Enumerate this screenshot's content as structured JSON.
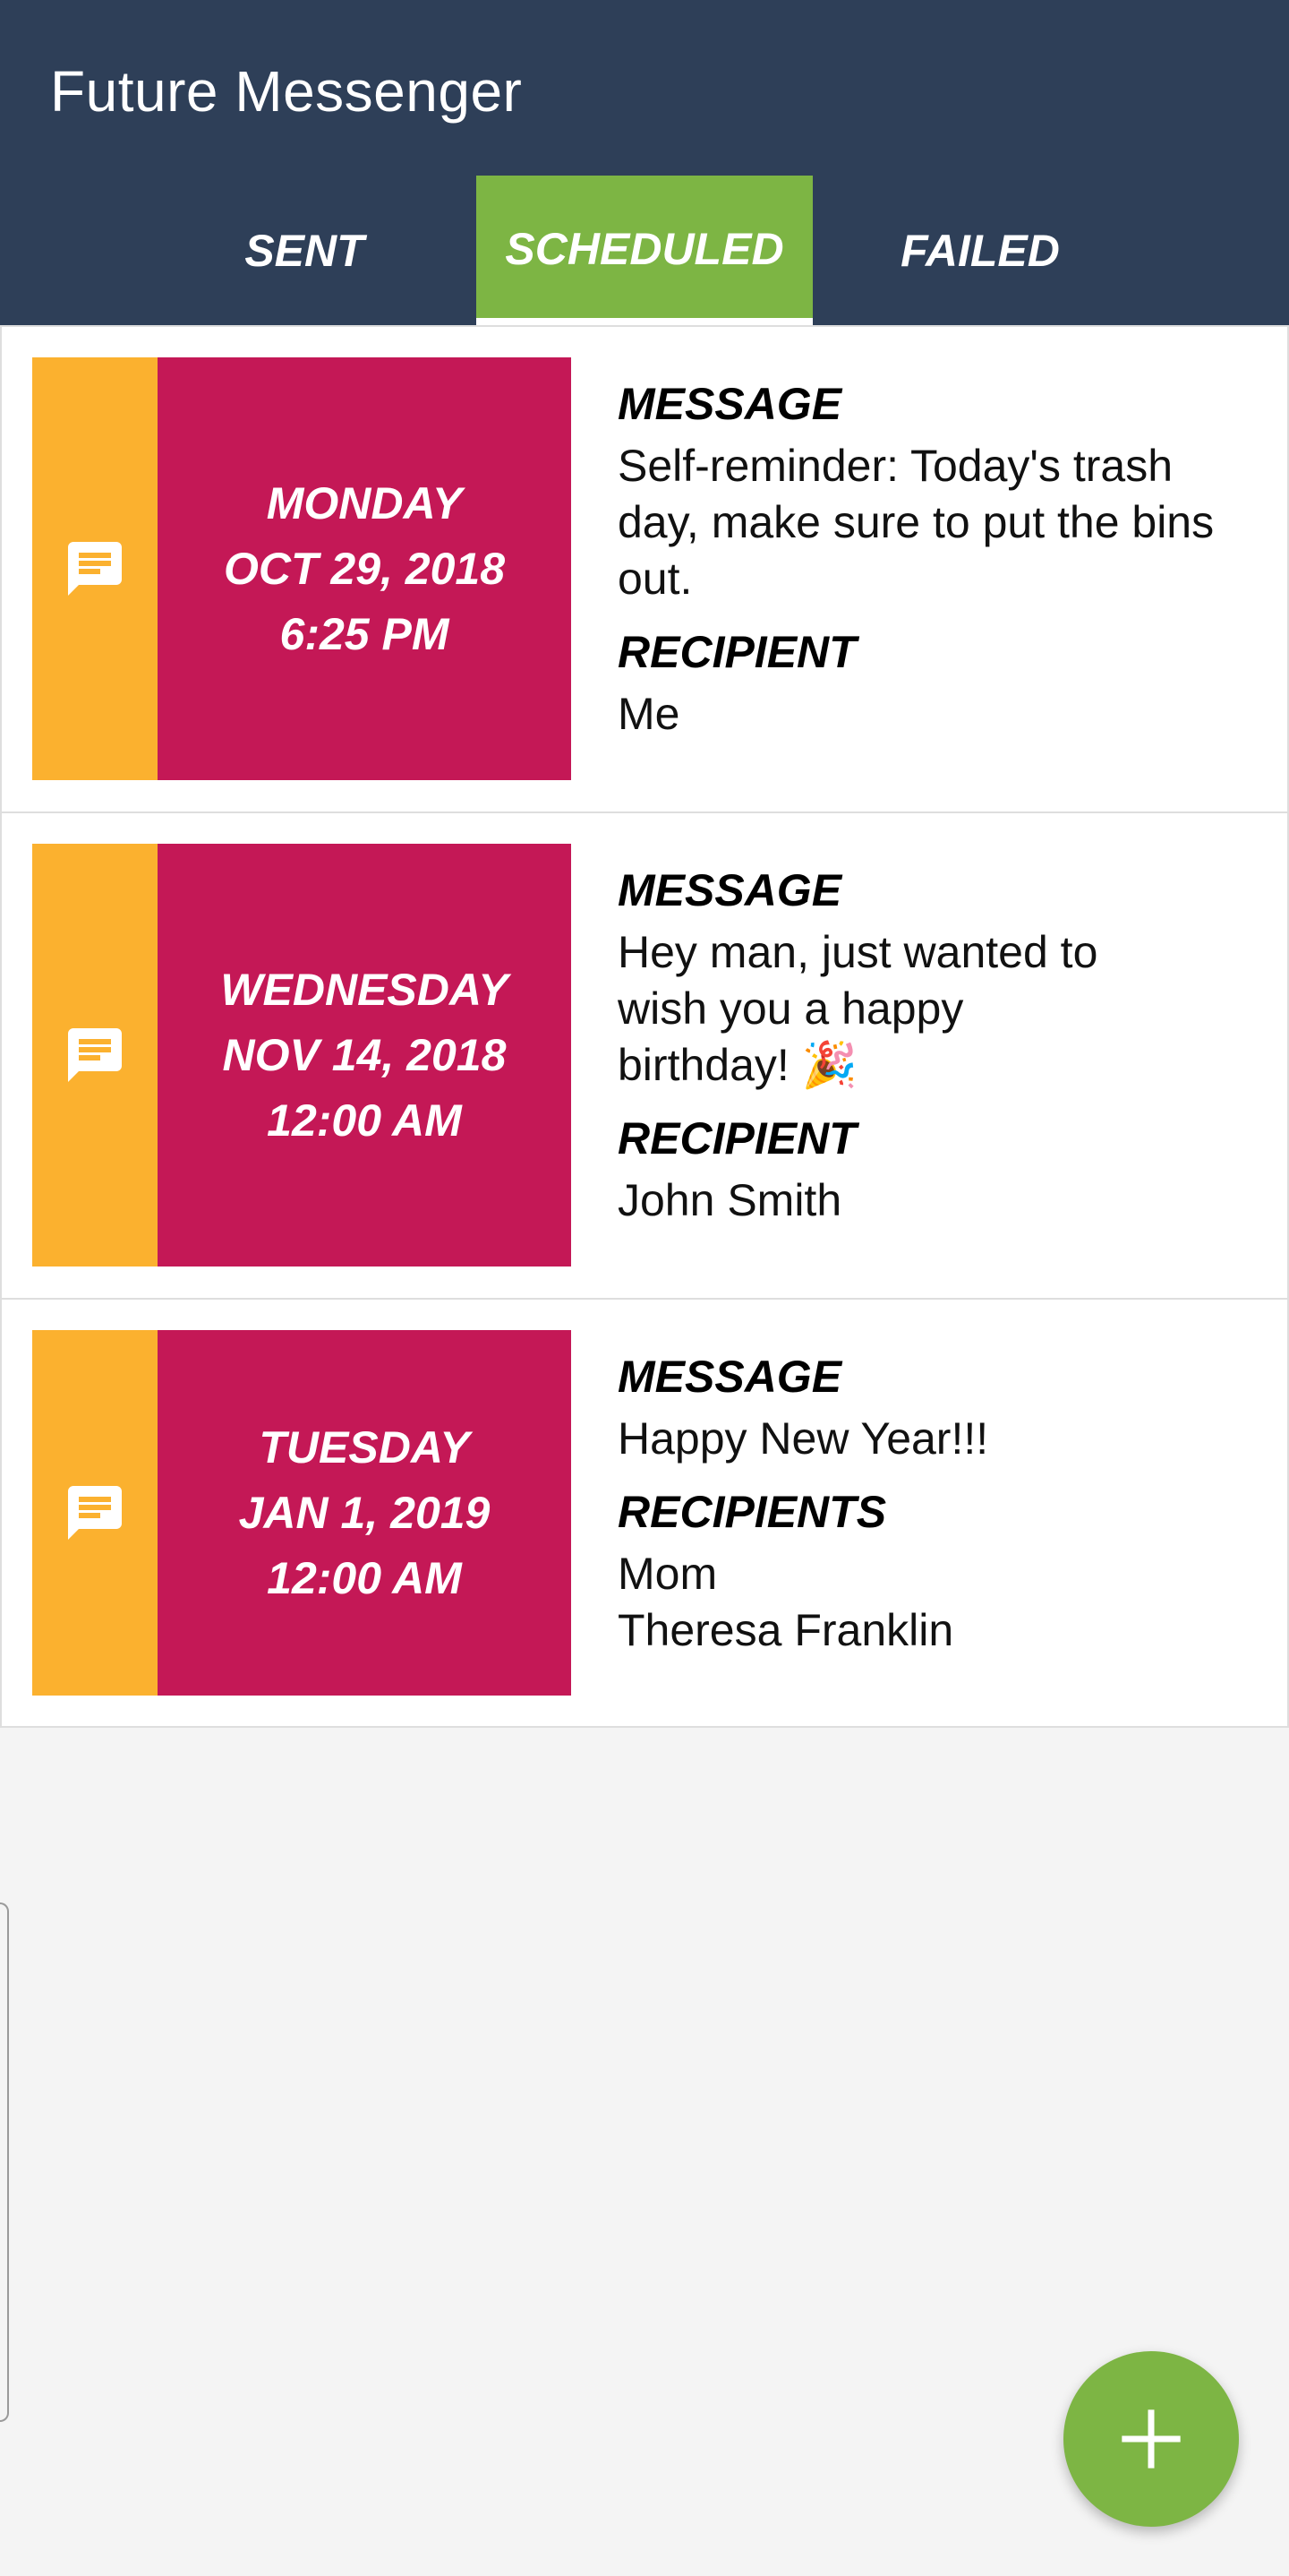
{
  "app": {
    "title": "Future Messenger"
  },
  "tabs": [
    {
      "label": "SENT",
      "active": false
    },
    {
      "label": "SCHEDULED",
      "active": true
    },
    {
      "label": "FAILED",
      "active": false
    }
  ],
  "colors": {
    "appbar": "#2e3f58",
    "active_tab": "#7db544",
    "strip": "#fbb12f",
    "date_box": "#c41856",
    "fab": "#7db544"
  },
  "messages": [
    {
      "icon": "message-icon",
      "date": {
        "day": "MONDAY",
        "date": "OCT 29, 2018",
        "time": "6:25 PM"
      },
      "message_label": "MESSAGE",
      "message": "Self-reminder: Today's trash day, make sure to put the bins out.",
      "recipient_label": "RECIPIENT",
      "recipients": [
        "Me"
      ]
    },
    {
      "icon": "message-icon",
      "date": {
        "day": "WEDNESDAY",
        "date": "NOV 14, 2018",
        "time": "12:00 AM"
      },
      "message_label": "MESSAGE",
      "message": "Hey man, just wanted to wish you a happy birthday! 🎉",
      "recipient_label": "RECIPIENT",
      "recipients": [
        "John Smith"
      ]
    },
    {
      "icon": "message-icon",
      "date": {
        "day": "TUESDAY",
        "date": "JAN 1, 2019",
        "time": "12:00 AM"
      },
      "message_label": "MESSAGE",
      "message": "Happy New Year!!!",
      "recipient_label": "RECIPIENTS",
      "recipients": [
        "Mom",
        "Theresa Franklin"
      ]
    }
  ],
  "fab": {
    "icon": "plus-icon"
  }
}
